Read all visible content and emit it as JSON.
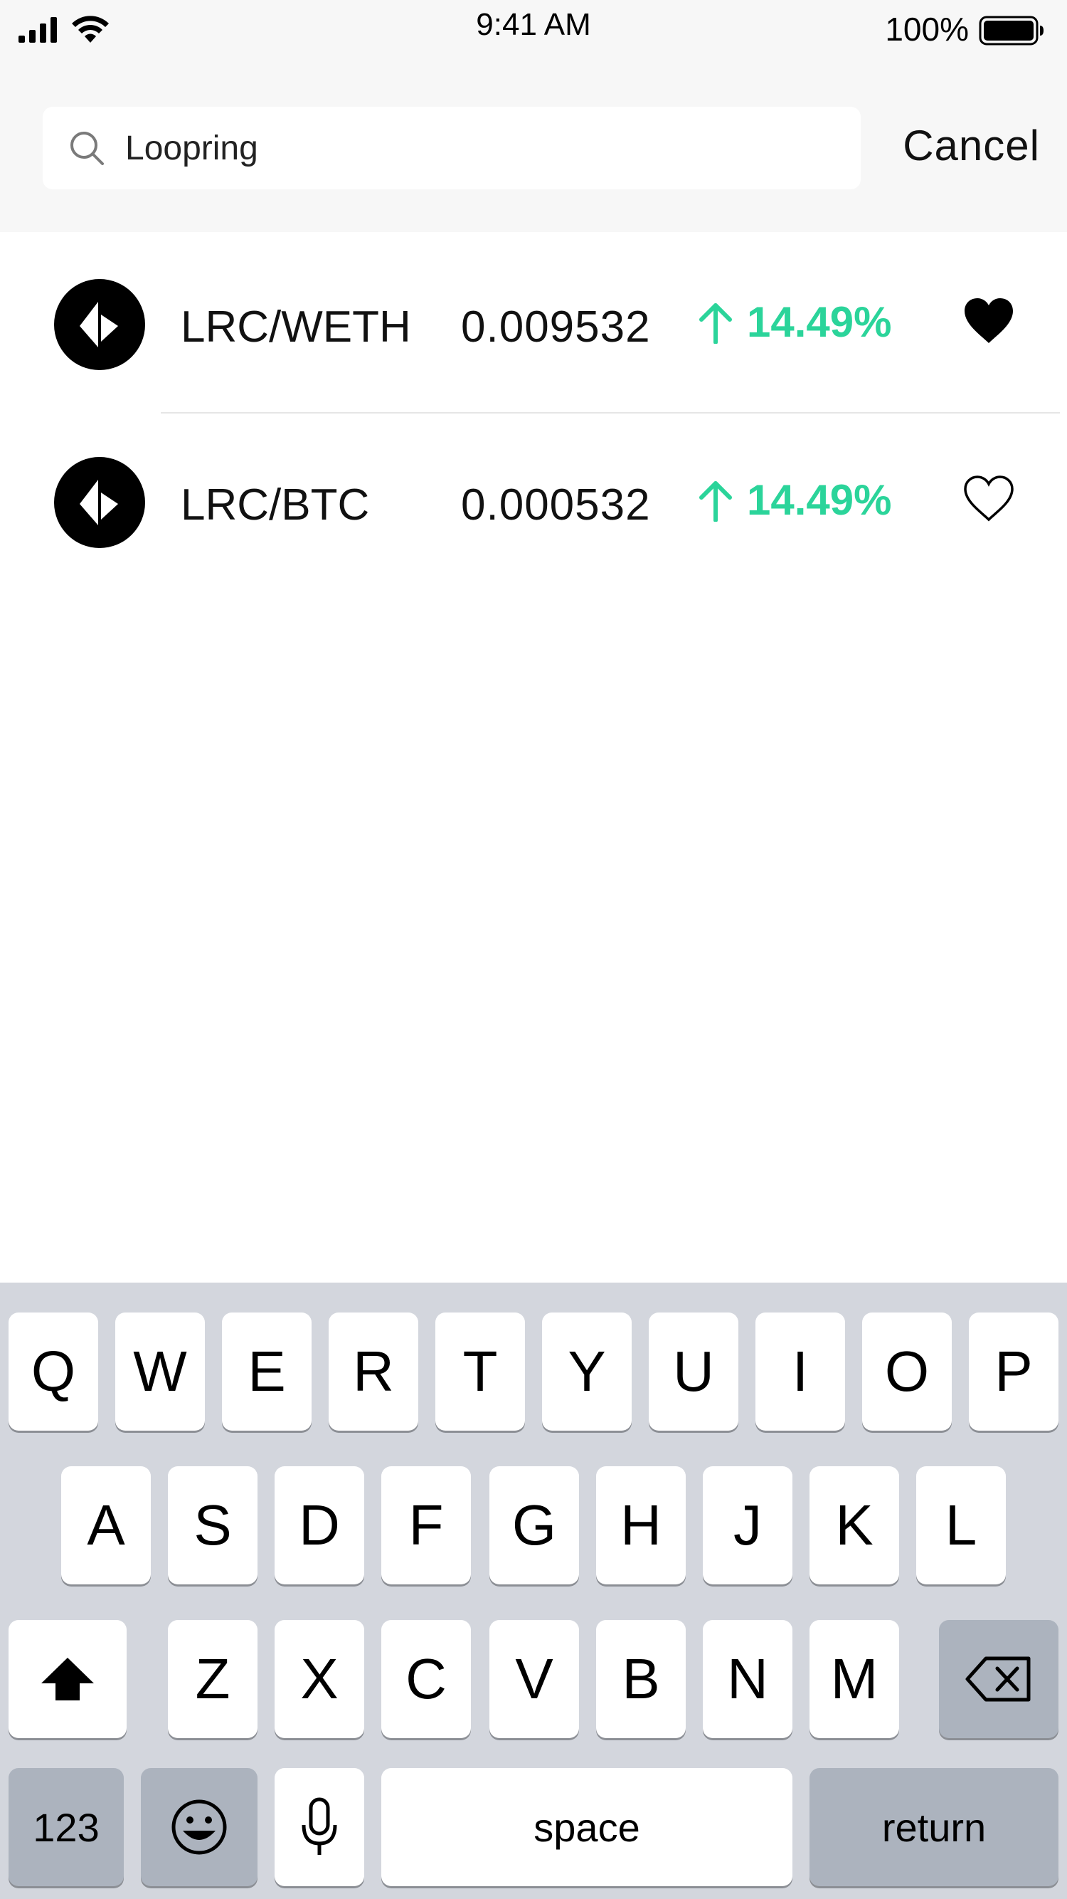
{
  "status_bar": {
    "time": "9:41 AM",
    "battery_percent": "100%",
    "icons": [
      "signal-icon",
      "wifi-icon",
      "battery-icon"
    ]
  },
  "search": {
    "value": "Loopring",
    "icon": "search-icon",
    "cancel_label": "Cancel"
  },
  "results": [
    {
      "pair": "LRC/WETH",
      "price": "0.009532",
      "change": "14.49%",
      "direction": "up",
      "favorited": true
    },
    {
      "pair": "LRC/BTC",
      "price": "0.000532",
      "change": "14.49%",
      "direction": "up",
      "favorited": false
    }
  ],
  "colors": {
    "positive": "#2bd49a",
    "top_background": "#f7f7f7",
    "keyboard_background": "#d3d6dd"
  },
  "keyboard": {
    "row1": [
      "Q",
      "W",
      "E",
      "R",
      "T",
      "Y",
      "U",
      "I",
      "O",
      "P"
    ],
    "row2": [
      "A",
      "S",
      "D",
      "F",
      "G",
      "H",
      "J",
      "K",
      "L"
    ],
    "row3": [
      "Z",
      "X",
      "C",
      "V",
      "B",
      "N",
      "M"
    ],
    "numbers_label": "123",
    "space_label": "space",
    "return_label": "return"
  }
}
